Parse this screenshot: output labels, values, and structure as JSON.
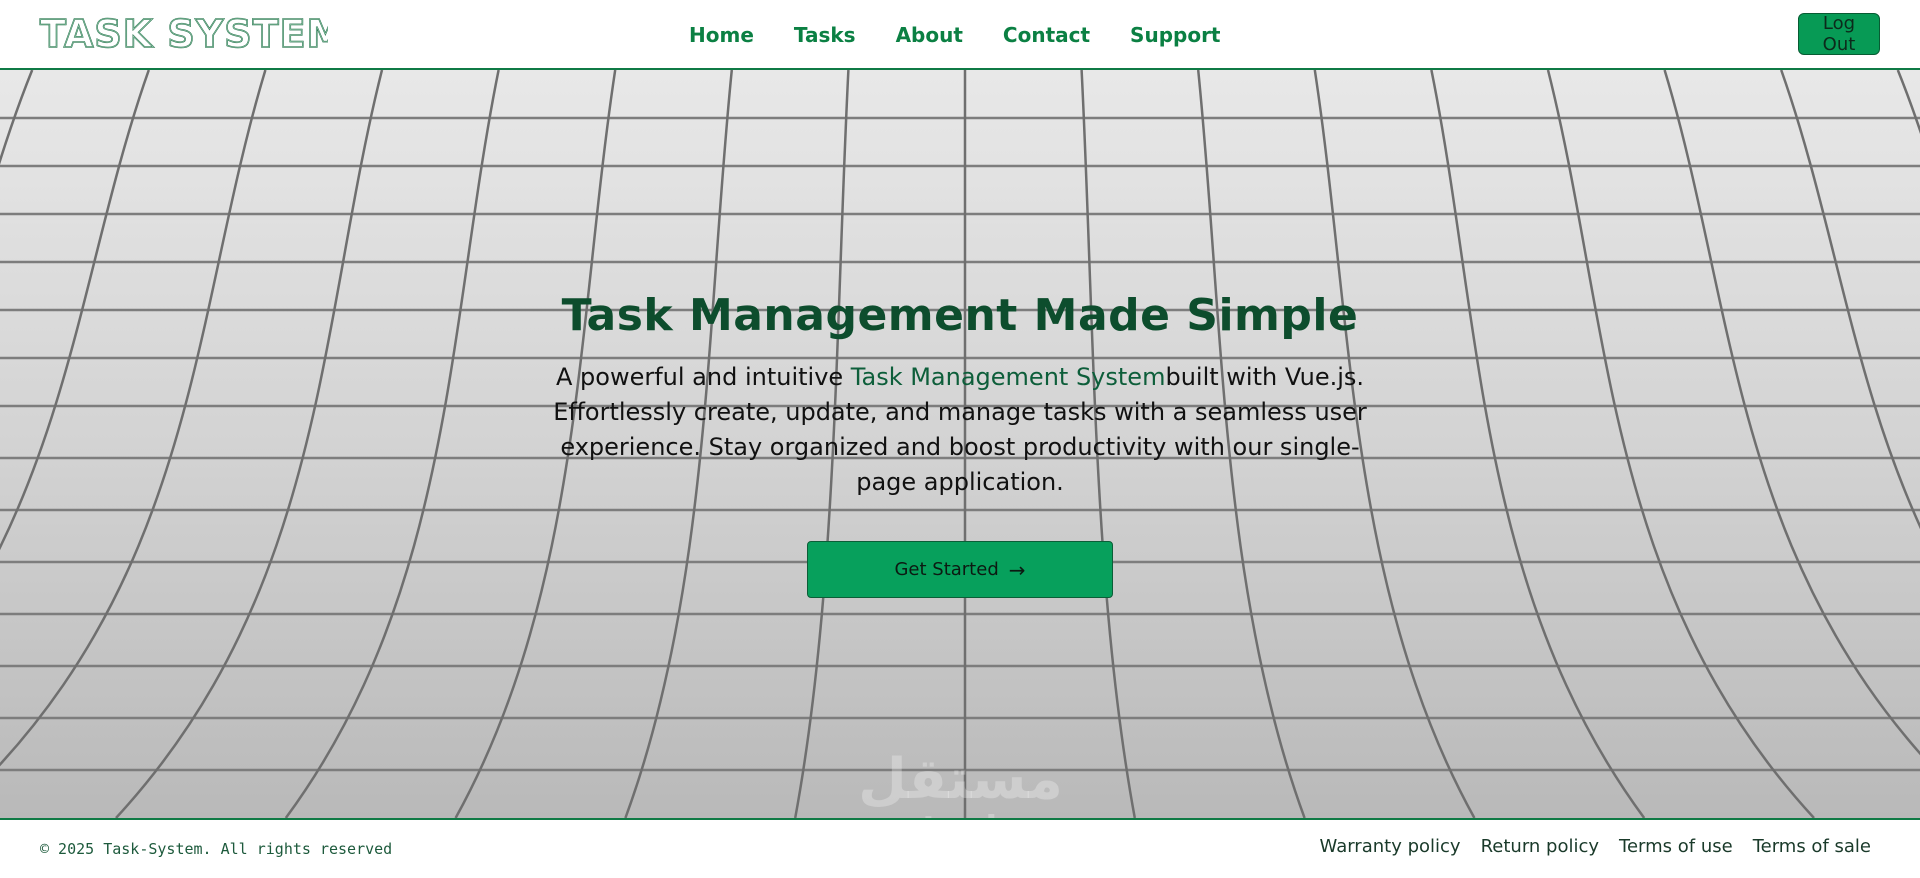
{
  "header": {
    "logo_text": "TASK SYSTEM",
    "nav": [
      {
        "label": "Home"
      },
      {
        "label": "Tasks"
      },
      {
        "label": "About"
      },
      {
        "label": "Contact"
      },
      {
        "label": "Support"
      }
    ],
    "logout_label": "Log Out"
  },
  "hero": {
    "title": "Task Management Made Simple",
    "desc_before": "A powerful and intuitive ",
    "desc_highlight": "Task Management System",
    "desc_after": "built with Vue.js. Effortlessly create, update, and manage tasks with a seamless user experience. Stay organized and boost productivity with our single-page application.",
    "cta_label": "Get Started",
    "cta_icon": "arrow-right-icon",
    "watermark_ar": "مستقل",
    "watermark_latin": "mostaql.com"
  },
  "footer": {
    "copyright": "© 2025 Task-System. All rights reserved",
    "links": [
      {
        "label": "Warranty policy"
      },
      {
        "label": "Return policy"
      },
      {
        "label": "Terms of use"
      },
      {
        "label": "Terms of sale"
      }
    ]
  },
  "colors": {
    "brand_green": "#0b8043",
    "button_green": "#07a05c",
    "title_green": "#0d4d2d"
  }
}
